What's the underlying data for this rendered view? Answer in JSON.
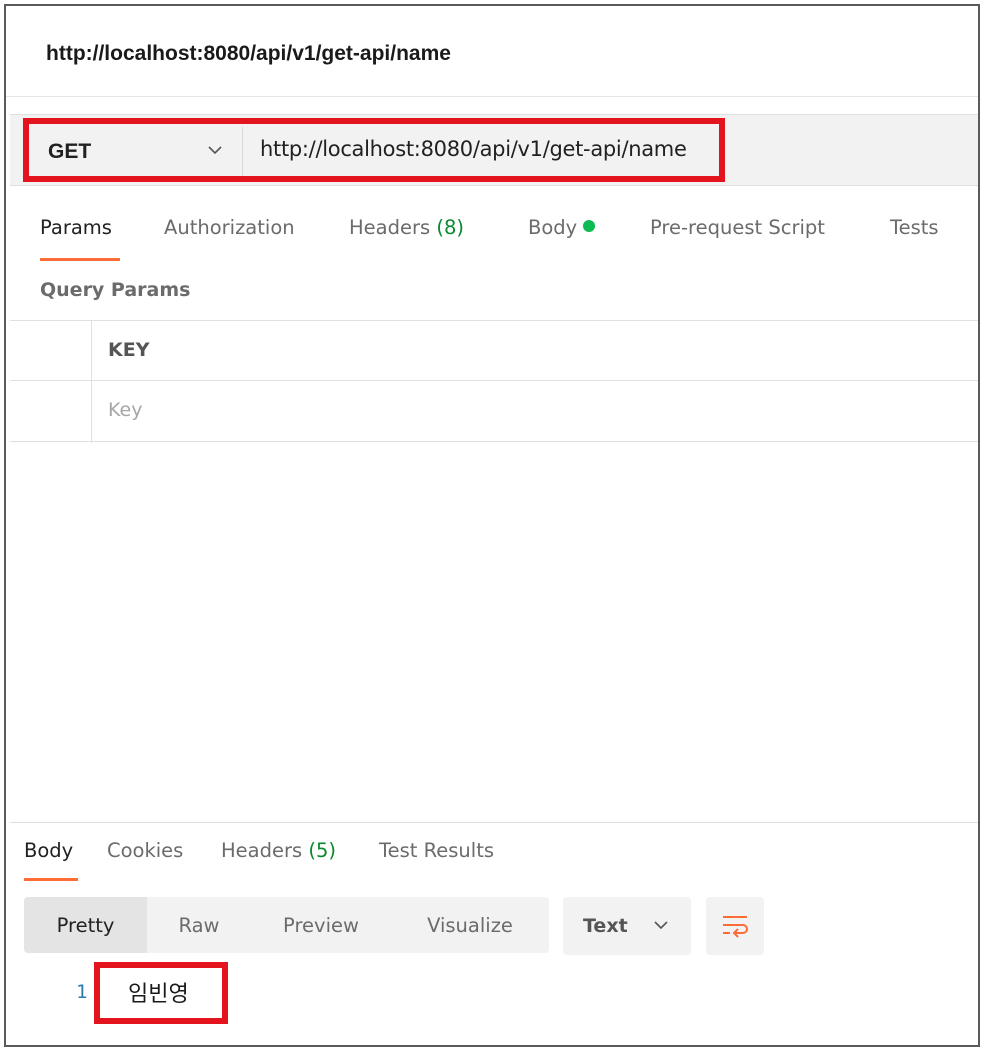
{
  "request": {
    "title": "http://localhost:8080/api/v1/get-api/name",
    "method": "GET",
    "url": "http://localhost:8080/api/v1/get-api/name"
  },
  "request_tabs": [
    {
      "label": "Params",
      "count": ""
    },
    {
      "label": "Authorization",
      "count": ""
    },
    {
      "label": "Headers",
      "count": "(8)"
    },
    {
      "label": "Body",
      "count": ""
    },
    {
      "label": "Pre-request Script",
      "count": ""
    },
    {
      "label": "Tests",
      "count": ""
    }
  ],
  "params": {
    "section_label": "Query Params",
    "column_key": "KEY",
    "key_placeholder": "Key"
  },
  "response_tabs": [
    {
      "label": "Body",
      "count": ""
    },
    {
      "label": "Cookies",
      "count": ""
    },
    {
      "label": "Headers",
      "count": "(5)"
    },
    {
      "label": "Test Results",
      "count": ""
    }
  ],
  "view_modes": [
    "Pretty",
    "Raw",
    "Preview",
    "Visualize"
  ],
  "format": "Text",
  "response_body": {
    "line_number": "1",
    "text": "임빈영"
  },
  "colors": {
    "accent": "#ff6c37",
    "highlight": "#e3141e",
    "status_dot": "#0cbb52",
    "count_green": "#0a8a2e"
  },
  "icons": [
    "chevron-down-icon",
    "wrap-lines-icon"
  ]
}
